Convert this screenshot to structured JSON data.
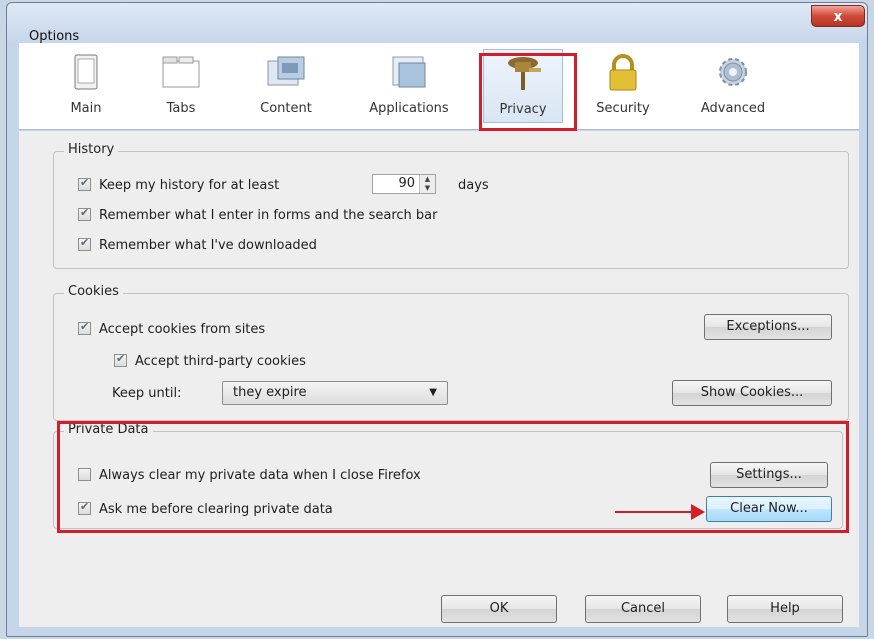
{
  "window": {
    "title": "Options",
    "close_label": "x"
  },
  "tabs": [
    {
      "label": "Main",
      "icon": "main-icon"
    },
    {
      "label": "Tabs",
      "icon": "tabs-icon"
    },
    {
      "label": "Content",
      "icon": "content-icon"
    },
    {
      "label": "Applications",
      "icon": "applications-icon"
    },
    {
      "label": "Privacy",
      "icon": "privacy-icon",
      "selected": true
    },
    {
      "label": "Security",
      "icon": "lock-icon"
    },
    {
      "label": "Advanced",
      "icon": "gear-icon"
    }
  ],
  "history": {
    "legend": "History",
    "keep_label": "Keep my history for at least",
    "keep_days": "90",
    "days_label": "days",
    "forms_label": "Remember what I enter in forms and the search bar",
    "downloads_label": "Remember what I've downloaded",
    "keep_checked": true,
    "forms_checked": true,
    "downloads_checked": true
  },
  "cookies": {
    "legend": "Cookies",
    "accept_label": "Accept cookies from sites",
    "third_party_label": "Accept third-party cookies",
    "keep_until_label": "Keep until:",
    "keep_until_value": "they expire",
    "exceptions_button": "Exceptions...",
    "show_cookies_button": "Show Cookies...",
    "accept_checked": true,
    "third_party_checked": true
  },
  "private_data": {
    "legend": "Private Data",
    "always_clear_label": "Always clear my private data when I close Firefox",
    "ask_label": "Ask me before clearing private data",
    "settings_button": "Settings...",
    "clear_now_button": "Clear Now...",
    "always_clear_checked": false,
    "ask_checked": true
  },
  "footer": {
    "ok": "OK",
    "cancel": "Cancel",
    "help": "Help"
  },
  "colors": {
    "highlight": "#d21e2a",
    "window_chrome": "#c6d6ea"
  }
}
